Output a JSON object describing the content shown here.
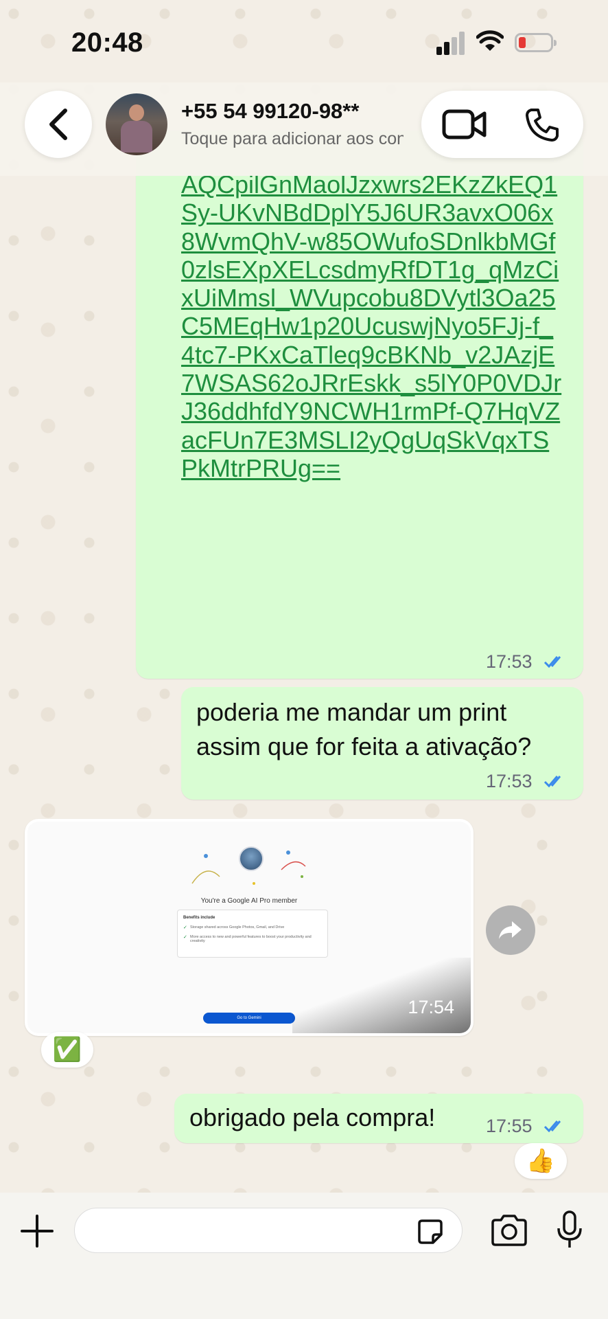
{
  "status_bar": {
    "time": "20:48",
    "battery_color": "#e53935"
  },
  "header": {
    "contact_name": "+55 54 99120-98**",
    "contact_subtitle": "Toque para adicionar aos contatos",
    "back_icon": "chevron-left-icon",
    "video_icon": "video-camera-icon",
    "phone_icon": "phone-icon"
  },
  "messages": {
    "link": {
      "text": "AQCpilGnMaolJzxwrs2EKzZkEQ1Sy-UKvNBdDplY5J6UR3avxO06x8WvmQhV-w85OWufoSDnlkbMGf0zlsEXpXELcsdmyRfDT1g_qMzCixUiMmsl_WVupcobu8DVytl3Oa25C5MEqHw1p20UcuswjNyo5FJj-f_4tc7-PKxCaTleq9cBKNb_v2JAzjE7WSAS62oJRrEskk_s5lY0P0VDJrJ36ddhfdY9NCWH1rmPf-Q7HqVZacFUn7E3MSLI2yQgUqSkVqxTSPkMtrPRUg==",
      "time": "17:53",
      "status": "read"
    },
    "print_request": {
      "text": "poderia me mandar um print assim que for feita a ativação?",
      "time": "17:53",
      "status": "read"
    },
    "image": {
      "time": "17:54",
      "screenshot_title": "You're a Google AI Pro member",
      "benefits_title": "Benefits include",
      "benefit_1": "Storage shared across Google Photos, Gmail, and Drive",
      "benefit_2": "More access to new and powerful features to boost your productivity and creativity",
      "button_label": "Go to Gemini",
      "reaction": "✅"
    },
    "thanks": {
      "text": "obrigado pela compra!",
      "time": "17:55",
      "status": "read",
      "reaction": "👍"
    }
  },
  "colors": {
    "outgoing_bubble": "#d9fdd3",
    "link": "#1e8e3e",
    "read_ticks": "#3b8beb"
  },
  "input_bar": {
    "placeholder": ""
  }
}
